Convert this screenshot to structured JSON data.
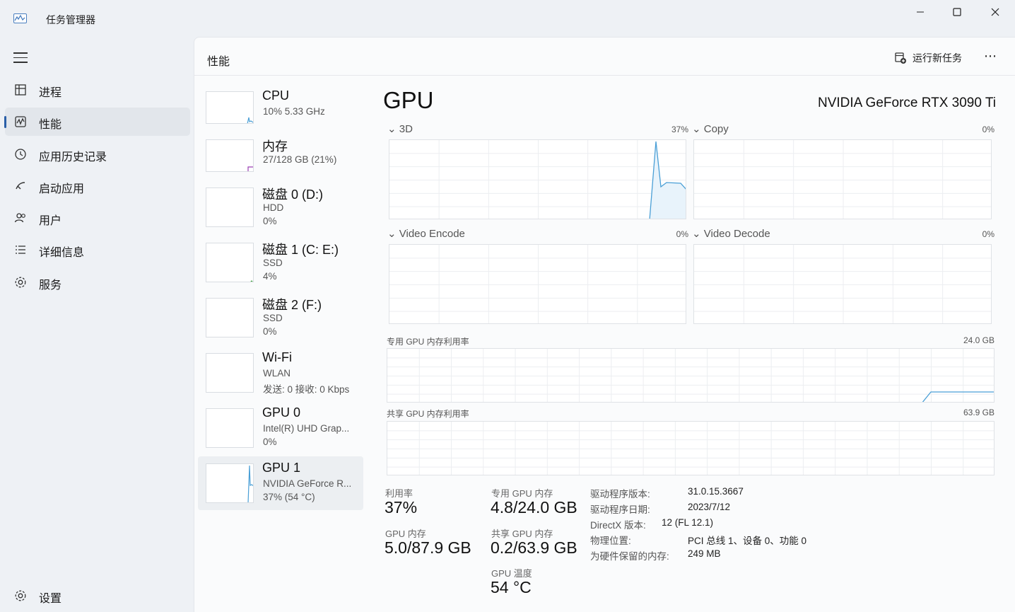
{
  "window": {
    "title": "任务管理器",
    "min_icon": "minimize-icon",
    "max_icon": "maximize-icon",
    "close_icon": "close-icon"
  },
  "sidebar": {
    "items": [
      {
        "label": "进程",
        "icon": "processes-icon"
      },
      {
        "label": "性能",
        "icon": "performance-icon",
        "active": true
      },
      {
        "label": "应用历史记录",
        "icon": "history-icon"
      },
      {
        "label": "启动应用",
        "icon": "startup-icon"
      },
      {
        "label": "用户",
        "icon": "users-icon"
      },
      {
        "label": "详细信息",
        "icon": "details-icon"
      },
      {
        "label": "服务",
        "icon": "services-icon"
      }
    ],
    "settings_label": "设置"
  },
  "header": {
    "title": "性能",
    "run_task_label": "运行新任务",
    "more": "⋯"
  },
  "devices": [
    {
      "name": "CPU",
      "line2": "10% 5.33 GHz",
      "line3": ""
    },
    {
      "name": "内存",
      "line2": "27/128 GB (21%)",
      "line3": ""
    },
    {
      "name": "磁盘 0 (D:)",
      "line2": "HDD",
      "line3": "0%"
    },
    {
      "name": "磁盘 1 (C: E:)",
      "line2": "SSD",
      "line3": "4%"
    },
    {
      "name": "磁盘 2 (F:)",
      "line2": "SSD",
      "line3": "0%"
    },
    {
      "name": "Wi-Fi",
      "line2": "WLAN",
      "line3": "发送: 0 接收: 0 Kbps"
    },
    {
      "name": "GPU 0",
      "line2": "Intel(R) UHD Grap...",
      "line3": "0%"
    },
    {
      "name": "GPU 1",
      "line2": "NVIDIA GeForce R...",
      "line3": "37% (54 °C)",
      "active": true
    }
  ],
  "detail": {
    "title": "GPU",
    "model": "NVIDIA GeForce RTX 3090 Ti",
    "engines": [
      {
        "label": "3D",
        "value": "37%"
      },
      {
        "label": "Copy",
        "value": "0%"
      },
      {
        "label": "Video Encode",
        "value": "0%"
      },
      {
        "label": "Video Decode",
        "value": "0%"
      }
    ],
    "dedicated_mem": {
      "label": "专用 GPU 内存利用率",
      "max": "24.0 GB"
    },
    "shared_mem": {
      "label": "共享 GPU 内存利用率",
      "max": "63.9 GB"
    },
    "stats": {
      "utilization_label": "利用率",
      "utilization": "37%",
      "dedicated_label": "专用 GPU 内存",
      "dedicated": "4.8/24.0 GB",
      "gpu_mem_label": "GPU 内存",
      "gpu_mem": "5.0/87.9 GB",
      "shared_label": "共享 GPU 内存",
      "shared": "0.2/63.9 GB",
      "temp_label": "GPU 温度",
      "temp": "54 °C"
    },
    "info": [
      {
        "k": "驱动程序版本:",
        "v": "31.0.15.3667"
      },
      {
        "k": "驱动程序日期:",
        "v": "2023/7/12"
      },
      {
        "k": "DirectX 版本:",
        "v": "12 (FL 12.1)"
      },
      {
        "k": "物理位置:",
        "v": "PCI 总线 1、设备 0、功能 0"
      },
      {
        "k": "为硬件保留的内存:",
        "v": "249 MB"
      }
    ]
  },
  "colors": {
    "accent": "#2a5fa8",
    "gpu_line": "#4a9fd6",
    "mem_line": "#9a3fb5"
  }
}
